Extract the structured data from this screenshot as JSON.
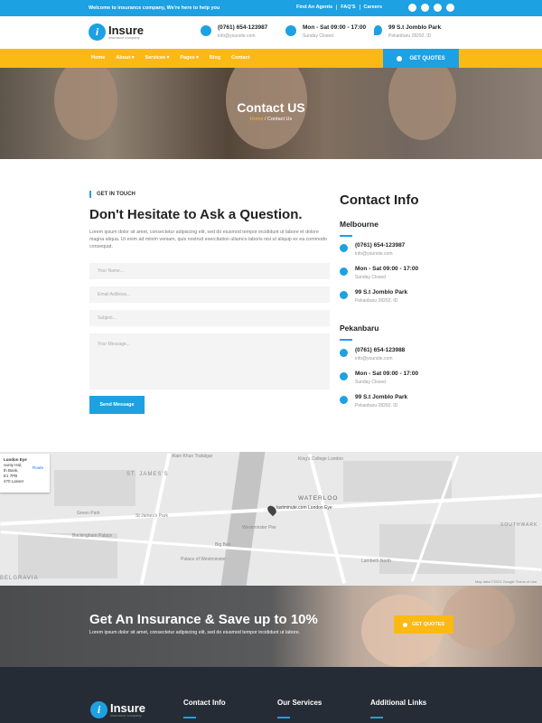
{
  "topbar": {
    "welcome": "Welcome to insurance company, We're here to help you",
    "links": [
      "Find An Agents",
      "FAQ'S",
      "Careers"
    ],
    "social": [
      "facebook-icon",
      "twitter-icon",
      "youtube-icon",
      "whatsapp-icon"
    ]
  },
  "header": {
    "logo_name": "Insure",
    "logo_tag": "insurance company",
    "phone": "(0761) 654-123987",
    "email": "info@yoursite.com",
    "hours": "Mon - Sat 09:00 - 17:00",
    "closed": "Sunday Closed",
    "address": "99 S.t Jomblo Park",
    "city": "Pekanbaru 28292. ID"
  },
  "nav": {
    "items": [
      "Home",
      "About ▾",
      "Services ▾",
      "Pages ▾",
      "Blog",
      "Contact"
    ],
    "quote": "GET QUOTES"
  },
  "hero": {
    "title": "Contact US",
    "crumb_home": "Home",
    "crumb_current": " / Contact Us"
  },
  "form": {
    "kicker": "GET IN TOUCH",
    "heading": "Don't Hesitate to Ask a Question.",
    "text": "Lorem ipsum dolor sit amet, consectetur adipiscing elit, sed do eiusmod tempor incididunt ut labore et dolore magna aliqua. Ut enim ad minim veniam, quis nostrud exercitation ullamco laboris nisi ut aliquip ex ea commodo consequat.",
    "name_ph": "Your Name...",
    "email_ph": "Email Address...",
    "subject_ph": "Subject...",
    "message_ph": "Your Message...",
    "send": "Send Message"
  },
  "info": {
    "title": "Contact Info",
    "offices": [
      {
        "city": "Melbourne",
        "phone": "(0761) 654-123987",
        "email": "info@yoursite.com",
        "hours": "Mon - Sat 09:00 - 17:00",
        "closed": "Sunday Closed",
        "address": "99 S.t Jomblo Park",
        "zip": "Pekanbaru 28292. ID"
      },
      {
        "city": "Pekanbaru",
        "phone": "(0761) 654-123988",
        "email": "info@yoursite.com",
        "hours": "Mon - Sat 09:00 - 17:00",
        "closed": "Sunday Closed",
        "address": "99 S.t Jomblo Park",
        "zip": "Pekanbaru 28292. ID"
      }
    ]
  },
  "map": {
    "infobox_title": "London Eye",
    "infobox_lines": [
      "ounty Hal,",
      "th Bank,",
      "E1 7PB",
      "470 Lasser"
    ],
    "route": "Route",
    "labels": [
      "Alain Khun Trafalgar",
      "ST. JAMES'S",
      "WATERLOO",
      "BELGRAVIA",
      "SOUTHWARK",
      "Big Ben",
      "London Eye",
      "Westminster Pier",
      "St James's Park",
      "Buckingham Palace",
      "Green Park",
      "Palace of Westminster",
      "Lambeth North",
      "King's College London"
    ],
    "marker_label": "lastminute.com London Eye",
    "copyright": "Map data ©2021 Google  Terms of Use"
  },
  "cta": {
    "title": "Get An Insurance & Save up to 10%",
    "text": "Lorem ipsum dolor sit amet, consectetur adipiscing elit, sed do eiusmod tempor incididunt ut labore.",
    "button": "GET QUOTES"
  },
  "footer": {
    "logo_name": "Insure",
    "logo_tag": "insurance company",
    "columns": [
      "Contact Info",
      "Our Services",
      "Additional Links"
    ]
  },
  "colors": {
    "primary": "#1da1e2",
    "accent": "#fbb914",
    "footer": "#262c35"
  }
}
